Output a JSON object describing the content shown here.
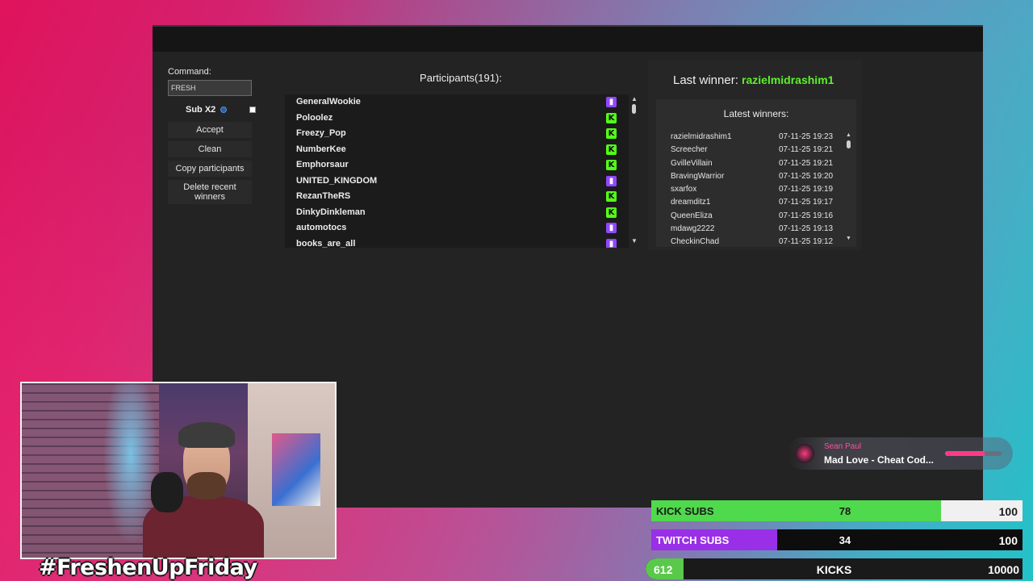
{
  "app": {
    "command_label": "Command:",
    "command_value": "FRESH",
    "sub_label": "Sub X2",
    "buttons": {
      "accept": "Accept",
      "clean": "Clean",
      "copy": "Copy participants",
      "delete": "Delete recent winners"
    },
    "participants_title": "Participants(191):",
    "participants": [
      {
        "name": "GeneralWookie",
        "platform": "twitch"
      },
      {
        "name": "Poloolez",
        "platform": "kick"
      },
      {
        "name": "Freezy_Pop",
        "platform": "kick"
      },
      {
        "name": "NumberKee",
        "platform": "kick"
      },
      {
        "name": "Emphorsaur",
        "platform": "kick"
      },
      {
        "name": "UNITED_KINGDOM",
        "platform": "twitch"
      },
      {
        "name": "RezanTheRS",
        "platform": "kick"
      },
      {
        "name": "DinkyDinkleman",
        "platform": "kick"
      },
      {
        "name": "automotocs",
        "platform": "twitch"
      },
      {
        "name": "books_are_all",
        "platform": "twitch"
      }
    ],
    "last_winner_label": "Last winner:",
    "last_winner_name": "razielmidrashim1",
    "latest_title": "Latest winners:",
    "latest_winners": [
      {
        "name": "razielmidrashim1",
        "time": "07-11-25 19:23"
      },
      {
        "name": "Screecher",
        "time": "07-11-25 19:21"
      },
      {
        "name": "GvilleVillain",
        "time": "07-11-25 19:21"
      },
      {
        "name": "BravingWarrior",
        "time": "07-11-25 19:20"
      },
      {
        "name": "sxarfox",
        "time": "07-11-25 19:19"
      },
      {
        "name": "dreamditz1",
        "time": "07-11-25 19:17"
      },
      {
        "name": "QueenEliza",
        "time": "07-11-25 19:16"
      },
      {
        "name": "mdawg2222",
        "time": "07-11-25 19:13"
      },
      {
        "name": "CheckinChad",
        "time": "07-11-25 19:12"
      }
    ]
  },
  "overlay": {
    "hashtag": "#FreshenUpFriday",
    "now_playing": {
      "artist": "Sean Paul",
      "title": "Mad Love - Cheat Cod...",
      "progress": 0.7
    },
    "bars": {
      "kick_subs": {
        "label": "KICK SUBS",
        "count": "78",
        "goal": "100",
        "fraction": 0.78,
        "color": "#4fd94c"
      },
      "twitch_subs": {
        "label": "TWITCH SUBS",
        "count": "34",
        "goal": "100",
        "fraction": 0.34,
        "color": "#9a2fe8"
      },
      "kicks": {
        "label": "KICKS",
        "count": "612",
        "goal": "10000",
        "fraction": 0.0612,
        "color": "#5ac84a"
      }
    }
  }
}
